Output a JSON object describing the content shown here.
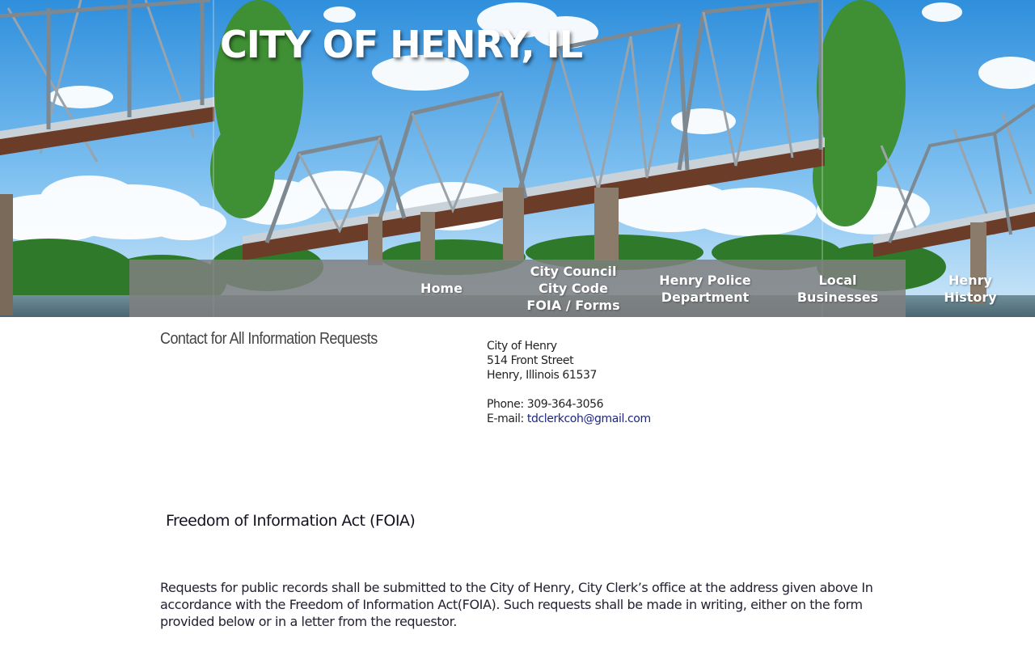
{
  "header": {
    "site_title": "CITY OF HENRY, IL"
  },
  "nav": {
    "home": "Home",
    "council_line1": "City Council",
    "council_line2": "City Code",
    "council_line3": "FOIA / Forms",
    "police_line1": "Henry Police",
    "police_line2": "Department",
    "business_line1": "Local",
    "business_line2": "Businesses",
    "history_line1": "Henry",
    "history_line2": "History"
  },
  "contact": {
    "heading": "Contact for All Information Requests",
    "org_name": "City of Henry",
    "street": "514 Front Street",
    "city_state_zip": "Henry, Illinois 61537",
    "phone": "Phone: 309-364-3056",
    "email_label": "E-mail: ",
    "email": "tdclerkcoh@gmail.com"
  },
  "foia": {
    "heading": "Freedom of Information Act (FOIA)",
    "body": "Requests for public records shall be submitted to the City of Henry, City Clerk’s office at the address given above In accordance with the Freedom of Information Act(FOIA). Such requests shall be made in writing, either on the form provided below or in a letter from the requestor."
  },
  "colors": {
    "nav_background": "#808080",
    "link": "#1c2580",
    "sky": "#5aaee8",
    "bridge_steel": "#8a8f96",
    "bridge_rust": "#7a4a32"
  },
  "icons": {
    "banner_image": "bridge-photo"
  }
}
